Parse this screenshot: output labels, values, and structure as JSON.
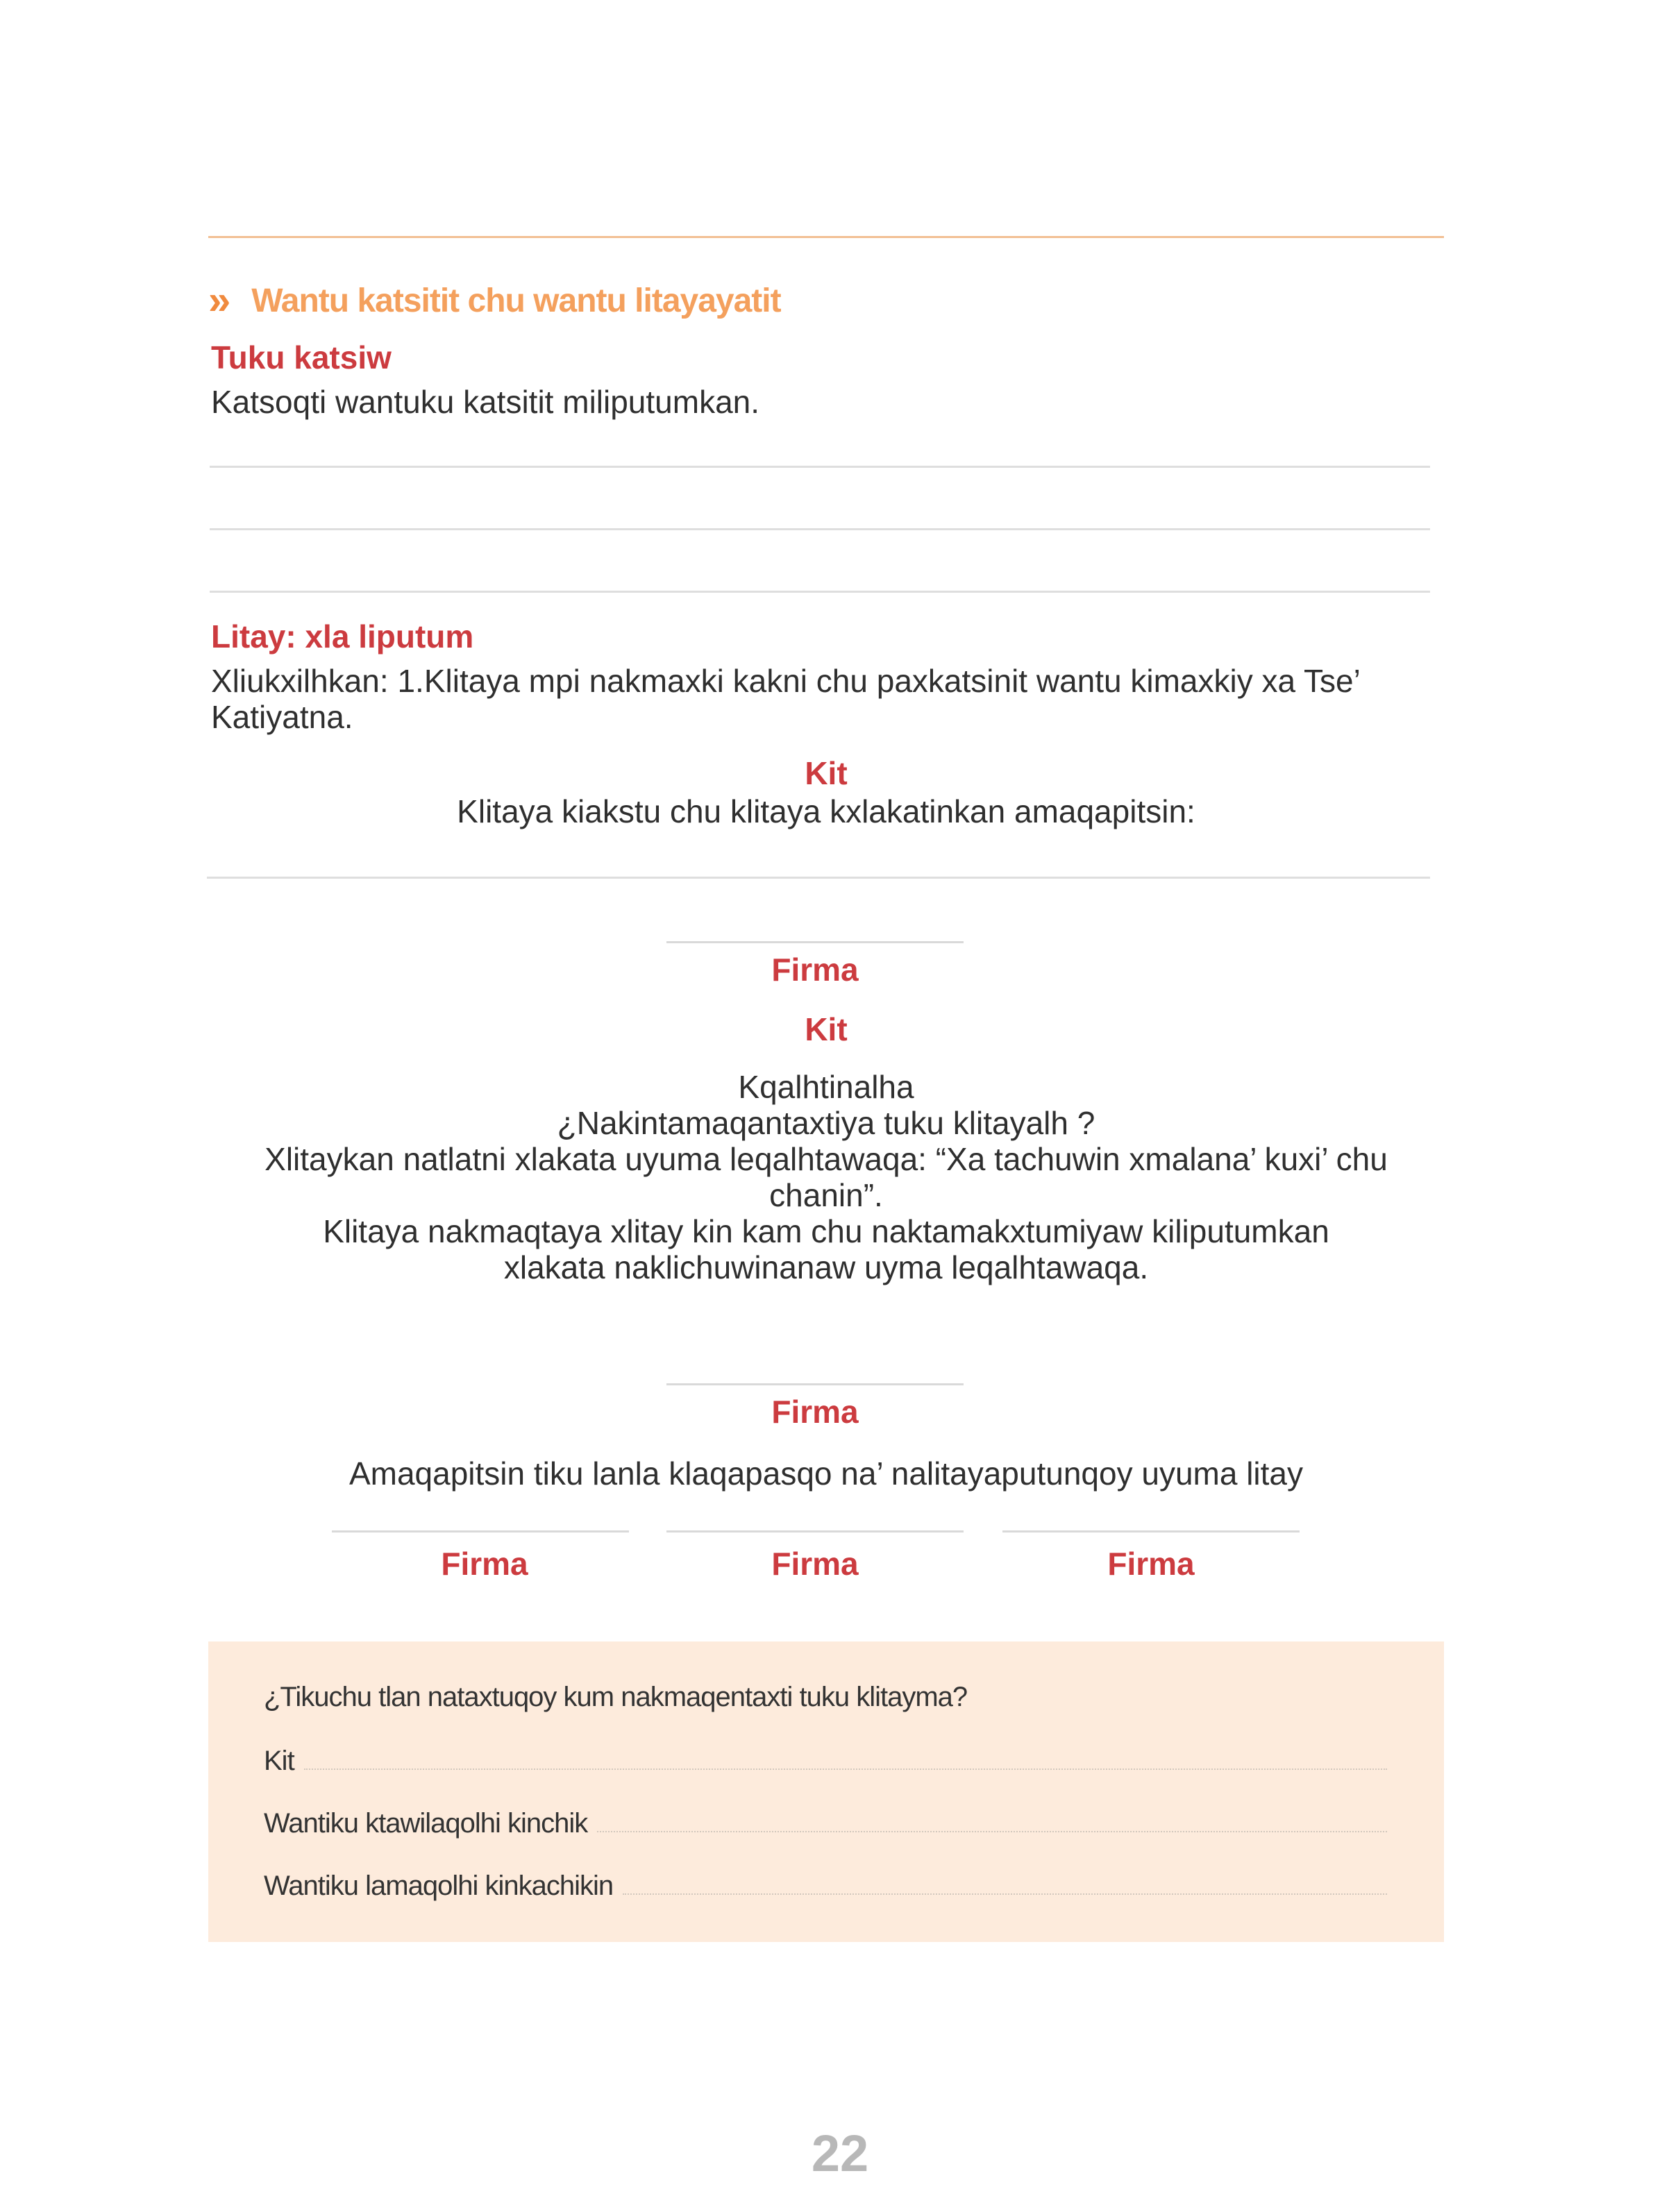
{
  "section": {
    "chevron": "»",
    "title": "Wantu katsitit chu wantu litayayatit"
  },
  "tuku": {
    "label": "Tuku  katsiw",
    "instruction": "Katsoqti wantuku katsitit miliputumkan."
  },
  "litay": {
    "label": "Litay: xla liputum",
    "text_line1": "Xliukxilhkan: 1.Klitaya mpi nakmaxki kakni chu paxkatsinit wantu kimaxkiy xa Tse’",
    "text_line2": "Katiyatna."
  },
  "kit1": {
    "label": "Kit",
    "text": "Klitaya kiakstu chu klitaya kxlakatinkan amaqapitsin:"
  },
  "firma1": "Firma",
  "kit2": {
    "label": "Kit",
    "lines": [
      "Kqalhtinalha",
      "¿Nakintamaqantaxtiya tuku klitayalh ?",
      "Xlitaykan natlatni xlakata uyuma leqalhtawaqa: “Xa tachuwin xmalana’ kuxi’ chu",
      "chanin”.",
      "Klitaya nakmaqtaya xlitay kin kam chu naktamakxtumiyaw kiliputumkan",
      "xlakata naklichuwinanaw uyma leqalhtawaqa."
    ]
  },
  "firma2": "Firma",
  "amaqapitsin": "Amaqapitsin tiku lanla klaqapasqo na’ nalitayaputunqoy uyuma litay",
  "firmas": [
    "Firma",
    "Firma",
    "Firma"
  ],
  "box": {
    "question": "¿Tikuchu tlan nataxtuqoy kum nakmaqentaxti tuku klitayma?",
    "fields": [
      "Kit",
      "Wantiku ktawilaqolhi kinchik",
      "Wantiku lamaqolhi kinkachikin"
    ]
  },
  "page_number": "22",
  "colors": {
    "orange_rule": "#f2bf93",
    "section_title": "#f4a05d",
    "red_label": "#cc3b3f",
    "box_bg": "#fdebdc",
    "page_number": "#b8b8b8"
  }
}
